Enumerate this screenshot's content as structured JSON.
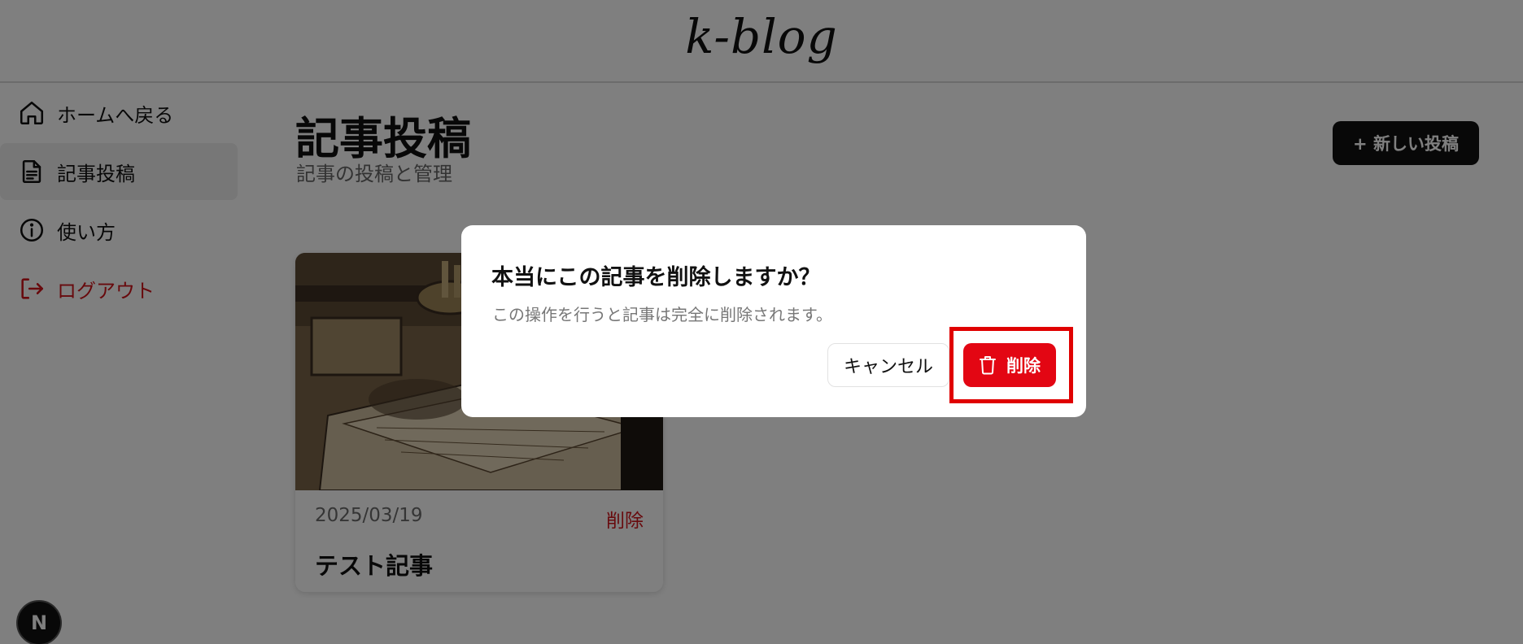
{
  "header": {
    "logo": "k-blog"
  },
  "sidebar": {
    "items": [
      {
        "label": "ホームへ戻る",
        "icon": "home-icon"
      },
      {
        "label": "記事投稿",
        "icon": "document-icon",
        "active": true
      },
      {
        "label": "使い方",
        "icon": "info-icon"
      },
      {
        "label": "ログアウト",
        "icon": "logout-icon",
        "color": "#d0141b"
      }
    ]
  },
  "main": {
    "title": "記事投稿",
    "subtitle": "記事の投稿と管理",
    "new_post_label": "+ 新しい投稿",
    "posts": [
      {
        "date": "2025/03/19",
        "delete_label": "削除",
        "title": "テスト記事"
      }
    ]
  },
  "dialog": {
    "title": "本当にこの記事を削除しますか？",
    "description": "この操作を行うと記事は完全に削除されます。",
    "cancel_label": "キャンセル",
    "delete_label": "削除",
    "delete_color": "#e30613"
  },
  "dev_badge": {
    "label": "N"
  }
}
